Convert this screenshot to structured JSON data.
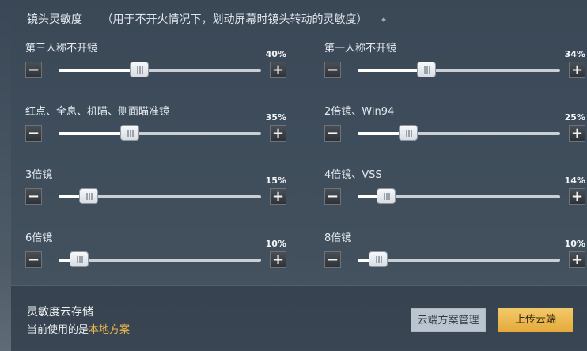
{
  "header": {
    "title": "镜头灵敏度",
    "note": "（用于不开火情况下，划动屏幕时镜头转动的灵敏度）"
  },
  "sliders": [
    {
      "label": "第三人称不开镜",
      "value_text": "40%",
      "value": 40
    },
    {
      "label": "第一人称不开镜",
      "value_text": "34%",
      "value": 34
    },
    {
      "label": "红点、全息、机瞄、侧面瞄准镜",
      "value_text": "35%",
      "value": 35
    },
    {
      "label": "2倍镜、Win94",
      "value_text": "25%",
      "value": 25
    },
    {
      "label": "3倍镜",
      "value_text": "15%",
      "value": 15
    },
    {
      "label": "4倍镜、VSS",
      "value_text": "14%",
      "value": 14
    },
    {
      "label": "6倍镜",
      "value_text": "10%",
      "value": 10
    },
    {
      "label": "8倍镜",
      "value_text": "10%",
      "value": 10
    }
  ],
  "controls": {
    "minus_symbol": "−",
    "plus_symbol": "+"
  },
  "footer": {
    "title": "灵敏度云存储",
    "current_prefix": "当前使用的是",
    "current_scheme": "本地方案",
    "manage_button": "云端方案管理",
    "upload_button": "上传云端"
  }
}
